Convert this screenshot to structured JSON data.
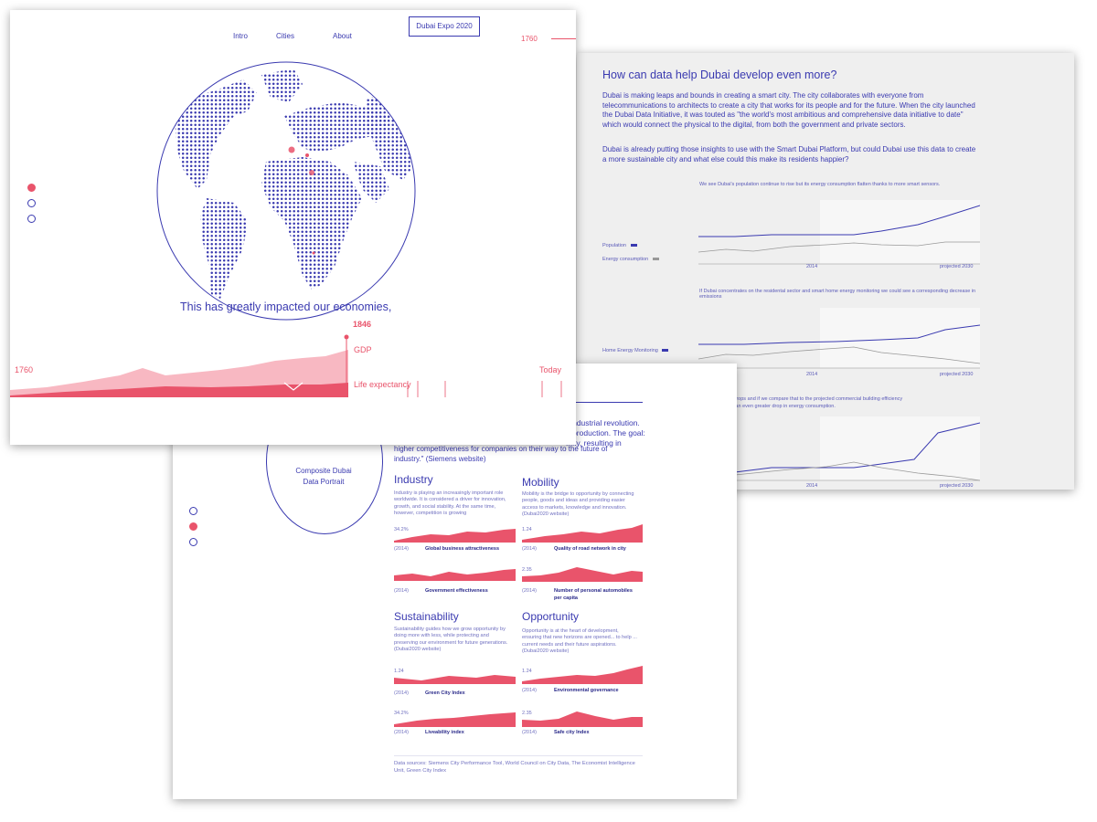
{
  "colors": {
    "accent": "#e9546b",
    "accent_light": "#f8b8c2",
    "primary": "#3a3ab0",
    "gray_bg": "#efefef"
  },
  "front": {
    "nav": {
      "intro": "Intro",
      "cities": "Cities",
      "about": "About",
      "cta": "Dubai Expo 2020"
    },
    "timeline_top_year": "1760",
    "tagline": "This has greatly impacted our economies,",
    "current_year": "1846",
    "start_year": "1760",
    "end_label": "Today",
    "legend_gdp": "GDP",
    "legend_life": "Life expectancy"
  },
  "right": {
    "title": "How can data help Dubai develop even more?",
    "para1": "Dubai is making leaps and bounds in creating a smart city. The city collaborates with everyone from telecommunications to architects to create a city that works for its people and for the future. When the city launched the Dubai Data Initiative, it was touted as \"the world's most ambitious and comprehensive data initiative to date\" which would connect the physical to the digital, from both the government and private sectors.",
    "para2": "Dubai is already putting those insights to use with the Smart Dubai Platform, but could Dubai use this data to create a more sustainable city and what else could this make its residents happier?",
    "chart1": {
      "caption": "We see Dubai's population continue to rise but its energy consumption flatten thanks to more smart sensors.",
      "legend1": "Population",
      "legend2": "Energy consumption",
      "x1": "2014",
      "x2": "projected 2030"
    },
    "chart2": {
      "caption": "If Dubai concentrates on the residental sector and smart home energy monitoring we could see a corresponding decrease in emissions",
      "legend1": "Home Energy Monitoring",
      "x1": "2014",
      "x2": "projected 2030"
    },
    "chart3": {
      "caption_line1": "...consumption drops and if we compare that to the projected commercial building efficiency",
      "caption_line2": "...we would see an even greater drop in energy consumption.",
      "x1": "2014",
      "x2": "projected 2030"
    }
  },
  "back": {
    "circle_label": "Composite Dubai Data Portrait",
    "intro_fragment_1": "...ndustrial revolution.",
    "intro_fragment_2": "...production. The goal:",
    "intro_fragment_3": "...ity, resulting in",
    "intro_line4": "higher competitiveness for companies on their way to the future of",
    "intro_line5": "industry.\" (Siemens website)",
    "industry": {
      "title": "Industry",
      "desc": "Industry is playing an increasingly important role worldwide. It is considered a driver for innovation, growth, and social stability. At the same time, however, competition is growing",
      "m1_val": "34.2%",
      "m1_year": "(2014)",
      "m1_label": "Global business attractiveness",
      "m2_year": "(2014)",
      "m2_label": "Government effectiveness"
    },
    "mobility": {
      "title": "Mobility",
      "desc": "Mobility is the bridge to opportunity by connecting people, goods and ideas and providing easier access to markets, knowledge and innovation. (Dubai2020 website)",
      "m1_val": "1.24",
      "m1_year": "(2014)",
      "m1_label": "Quality of road network in city",
      "m2_val": "2.35",
      "m2_year": "(2014)",
      "m2_label_1": "Number of personal automobiles",
      "m2_label_2": "per capita"
    },
    "sustainability": {
      "title": "Sustainability",
      "desc": "Sustainability guides how we grow opportunity by doing more with less, while protecting and preserving our environment for future generations. (Dubai2020 website)",
      "m1_val": "1.24",
      "m1_year": "(2014)",
      "m1_label": "Green City Index",
      "m2_val": "34.2%",
      "m2_year": "(2014)",
      "m2_label": "Liveability index"
    },
    "opportunity": {
      "title": "Opportunity",
      "desc": "Opportunity is at the heart of development, ensuring that new horizons are opened... to help ... current needs and their future aspirations. (Dubai2020 website)",
      "m1_val": "1.24",
      "m1_year": "(2014)",
      "m1_label": "Environmental governance",
      "m2_val": "2.35",
      "m2_year": "(2014)",
      "m2_label": "Safe city Index"
    },
    "sources": "Data sources: Siemens City Performance Tool, World Council on City Data, The Economist Intelligence Unit, Green City Index"
  }
}
